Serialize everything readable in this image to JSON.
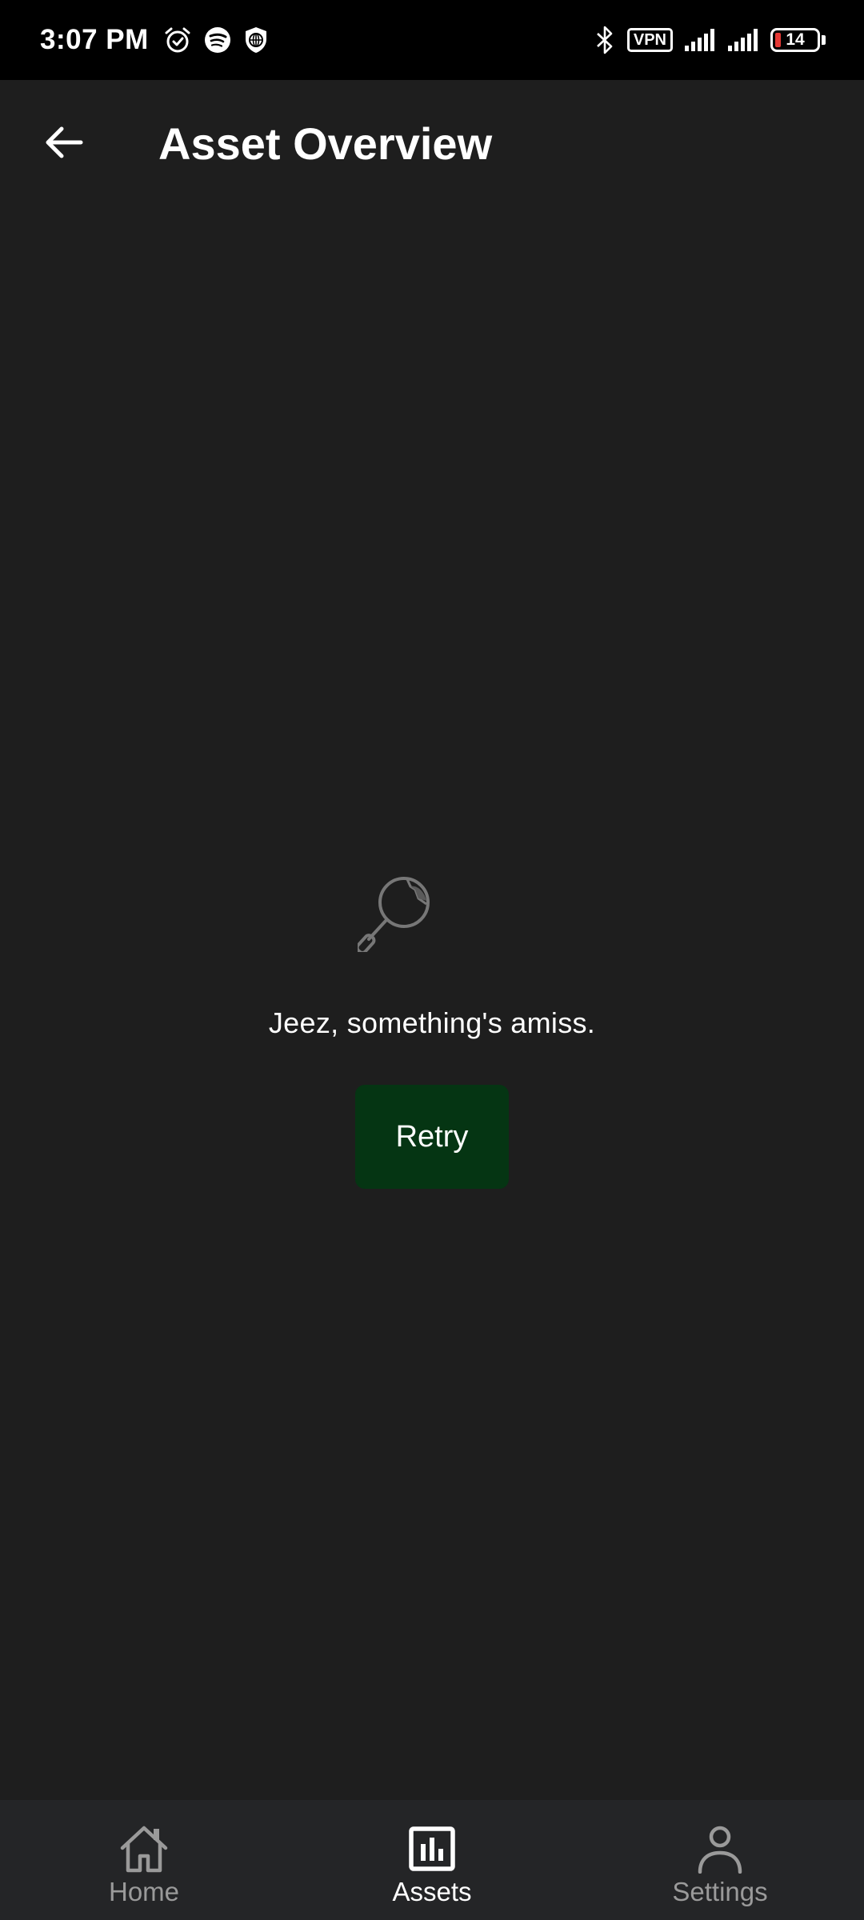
{
  "status_bar": {
    "time": "3:07 PM",
    "left_icons": [
      "alarm-icon",
      "spotify-icon",
      "vpn-shield-icon"
    ],
    "vpn_label": "VPN",
    "battery_level": "14",
    "battery_color": "#e53935",
    "right_icons": [
      "bluetooth-icon",
      "vpn-icon",
      "signal-icon",
      "signal-icon",
      "battery-icon"
    ]
  },
  "app_bar": {
    "title": "Asset Overview",
    "back_icon": "arrow-left-icon"
  },
  "error_state": {
    "icon": "broken-magnifier-icon",
    "message": "Jeez, something's amiss.",
    "retry_label": "Retry",
    "retry_color": "#053513"
  },
  "bottom_nav": {
    "items": [
      {
        "label": "Home",
        "icon": "home-icon",
        "active": false
      },
      {
        "label": "Assets",
        "icon": "bar-chart-icon",
        "active": true
      },
      {
        "label": "Settings",
        "icon": "person-icon",
        "active": false
      }
    ],
    "active_color": "#ffffff",
    "inactive_color": "#9a9a9a"
  },
  "colors": {
    "background": "#1e1e1e",
    "status_bar": "#000000",
    "nav_background": "#242527"
  }
}
